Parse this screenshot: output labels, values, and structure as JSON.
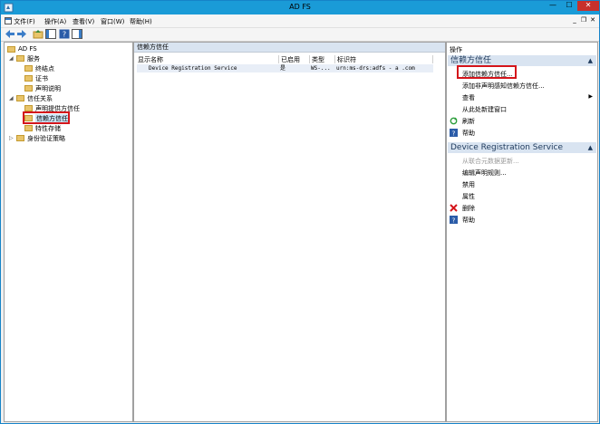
{
  "window": {
    "title": "AD FS"
  },
  "menubar": {
    "items": [
      "文件(F)",
      "操作(A)",
      "查看(V)",
      "窗口(W)",
      "帮助(H)"
    ]
  },
  "tree": {
    "root": "AD FS",
    "services": "服务",
    "endpoints": "终结点",
    "certificates": "证书",
    "claim_descriptions": "声明说明",
    "trust_relationships": "信任关系",
    "claims_provider_trusts": "声明提供方信任",
    "relying_party_trusts": "信赖方信任",
    "attribute_stores": "特性存储",
    "auth_policies": "身份验证策略"
  },
  "center": {
    "header": "信赖方信任",
    "columns": [
      "显示名称",
      "已启用",
      "类型",
      "标识符"
    ],
    "rows": [
      {
        "name": "Device Registration Service",
        "enabled": "是",
        "type": "WS-...",
        "identifier": "urn:ms-drs:adfs  -  a  .com"
      }
    ]
  },
  "actions": {
    "title": "操作",
    "section1": {
      "title": "信赖方信任",
      "items": [
        "添加信赖方信任...",
        "添加非声明感知信赖方信任...",
        "查看",
        "从此处新建窗口",
        "刷新",
        "帮助"
      ]
    },
    "section2": {
      "title": "Device Registration Service",
      "items": [
        "从联合元数据更新...",
        "编辑声明规则...",
        "禁用",
        "属性",
        "删除",
        "帮助"
      ]
    }
  },
  "colors": {
    "titlebar": "#1a9bd7",
    "highlight": "#d4151b",
    "section": "#d9e4f1"
  }
}
